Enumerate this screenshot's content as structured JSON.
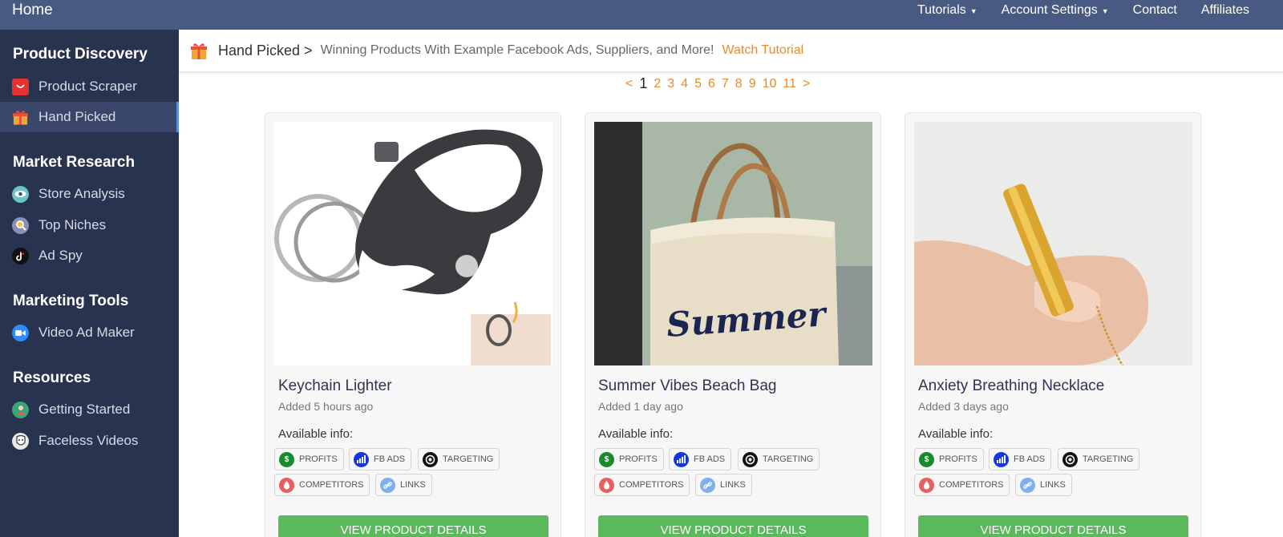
{
  "topbar": {
    "home": "Home",
    "nav": [
      {
        "label": "Tutorials",
        "dropdown": true
      },
      {
        "label": "Account Settings",
        "dropdown": true
      },
      {
        "label": "Contact",
        "dropdown": false
      },
      {
        "label": "Affiliates",
        "dropdown": false
      }
    ]
  },
  "sidebar": {
    "sections": [
      {
        "title": "Product Discovery",
        "items": [
          {
            "label": "Product Scraper",
            "icon": "shopping-bag-icon"
          },
          {
            "label": "Hand Picked",
            "icon": "gift-icon",
            "active": true
          }
        ]
      },
      {
        "title": "Market Research",
        "items": [
          {
            "label": "Store Analysis",
            "icon": "eye-icon"
          },
          {
            "label": "Top Niches",
            "icon": "magnifier-icon"
          },
          {
            "label": "Ad Spy",
            "icon": "tiktok-icon"
          }
        ]
      },
      {
        "title": "Marketing Tools",
        "items": [
          {
            "label": "Video Ad Maker",
            "icon": "video-camera-icon"
          }
        ]
      },
      {
        "title": "Resources",
        "items": [
          {
            "label": "Getting Started",
            "icon": "avatar-icon"
          },
          {
            "label": "Faceless Videos",
            "icon": "mask-icon"
          }
        ]
      }
    ]
  },
  "header": {
    "crumb": "Hand Picked >",
    "subtitle": "Winning Products With Example Facebook Ads, Suppliers, and More!",
    "tutorial": "Watch Tutorial"
  },
  "pagination": {
    "prev": "<",
    "pages": [
      "1",
      "2",
      "3",
      "4",
      "5",
      "6",
      "7",
      "8",
      "9",
      "10",
      "11"
    ],
    "current": "1",
    "next": ">"
  },
  "cards": [
    {
      "title": "Keychain Lighter",
      "added": "Added 5 hours ago"
    },
    {
      "title": "Summer Vibes Beach Bag",
      "added": "Added 1 day ago",
      "image_text": "Summer"
    },
    {
      "title": "Anxiety Breathing Necklace",
      "added": "Added 3 days ago"
    }
  ],
  "card_common": {
    "available": "Available info:",
    "tags": [
      "PROFITS",
      "FB ADS",
      "TARGETING",
      "COMPETITORS",
      "LINKS"
    ],
    "button": "VIEW PRODUCT DETAILS"
  },
  "colors": {
    "topbar": "#485a82",
    "sidebar": "#283350",
    "accent": "#e88a2e",
    "button": "#5cb85c"
  }
}
